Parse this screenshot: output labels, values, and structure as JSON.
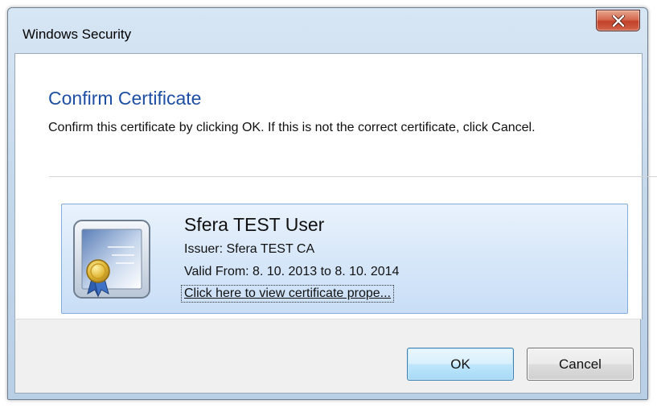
{
  "window": {
    "title": "Windows Security"
  },
  "dialog": {
    "heading": "Confirm Certificate",
    "description": "Confirm this certificate by clicking OK. If this is not the correct certificate, click Cancel."
  },
  "certificate": {
    "icon": "certificate-icon",
    "name": "Sfera TEST User",
    "issuer": "Issuer: Sfera TEST CA",
    "valid": "Valid From: 8. 10. 2013 to 8. 10. 2014",
    "link": "Click here to view certificate prope..."
  },
  "buttons": {
    "ok": "OK",
    "cancel": "Cancel"
  },
  "colors": {
    "heading": "#1e4fa3",
    "close_button": "#c2402a",
    "tile_border": "#84acdd"
  }
}
